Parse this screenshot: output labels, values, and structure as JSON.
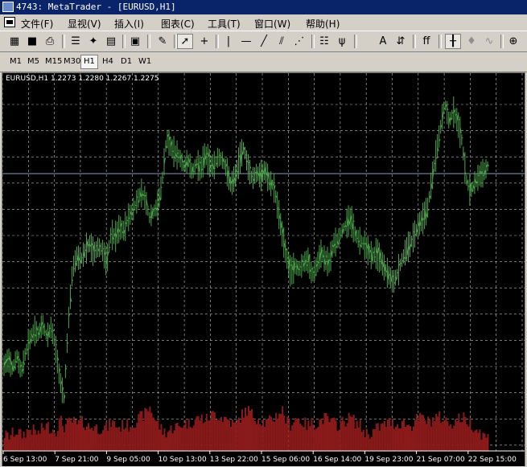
{
  "window": {
    "title": "4743: MetaTrader - [EURUSD,H1]"
  },
  "menu": [
    "文件(F)",
    "显视(V)",
    "插入(I)",
    "图表(C)",
    "工具(T)",
    "窗口(W)",
    "帮助(H)"
  ],
  "toolbar_icons": [
    "new-chart-icon",
    "save-icon",
    "print-icon",
    "market-watch-icon",
    "navigator-icon",
    "terminal-icon",
    "strategy-tester-icon",
    "properties-icon",
    "pencil-icon",
    "cursor-icon",
    "crosshair-icon",
    "vertical-line-icon",
    "horizontal-line-icon",
    "trendline-icon",
    "channel-icon",
    "gann-fan-icon",
    "fibonacci-icon",
    "andrews-pitchfork-icon",
    "text-icon",
    "arrow-label-icon",
    "fibonacci-fan-icon",
    "bar-chart-icon",
    "candlestick-icon",
    "line-chart-icon",
    "zoom-in-icon"
  ],
  "timeframes": [
    "M1",
    "M5",
    "M15",
    "M30",
    "H1",
    "H4",
    "D1",
    "W1"
  ],
  "active_timeframe": "H1",
  "chart": {
    "header": "EURUSD,H1  1.2273 1.2280 1.2267 1.2275",
    "bar_color": "#4ca64c",
    "volume_color": "#8b1a1a",
    "grid_color": "#c0c0c0",
    "price_line_color": "#8a9ab8"
  },
  "chart_data": {
    "type": "bar",
    "symbol": "EURUSD",
    "timeframe": "H1",
    "ohlc": {
      "open": 1.2273,
      "high": 1.228,
      "low": 1.2267,
      "close": 1.2275
    },
    "x_tick_labels": [
      "6 Sep 13:00",
      "7 Sep 21:00",
      "9 Sep 05:00",
      "10 Sep 13:00",
      "13 Sep 22:00",
      "15 Sep 06:00",
      "16 Sep 14:00",
      "19 Sep 23:00",
      "21 Sep 07:00",
      "22 Sep 15:00"
    ],
    "price_path_relative": [
      0.14,
      0.16,
      0.13,
      0.17,
      0.12,
      0.18,
      0.22,
      0.25,
      0.24,
      0.27,
      0.23,
      0.26,
      0.2,
      0.1,
      0.04,
      0.27,
      0.44,
      0.48,
      0.47,
      0.5,
      0.52,
      0.49,
      0.51,
      0.5,
      0.46,
      0.55,
      0.54,
      0.57,
      0.56,
      0.6,
      0.62,
      0.65,
      0.68,
      0.66,
      0.6,
      0.62,
      0.64,
      0.72,
      0.85,
      0.82,
      0.8,
      0.79,
      0.76,
      0.78,
      0.74,
      0.77,
      0.75,
      0.8,
      0.77,
      0.76,
      0.79,
      0.78,
      0.75,
      0.7,
      0.73,
      0.78,
      0.82,
      0.76,
      0.72,
      0.74,
      0.73,
      0.75,
      0.71,
      0.7,
      0.63,
      0.55,
      0.48,
      0.43,
      0.45,
      0.44,
      0.46,
      0.47,
      0.42,
      0.45,
      0.49,
      0.47,
      0.46,
      0.52,
      0.53,
      0.56,
      0.58,
      0.6,
      0.55,
      0.53,
      0.52,
      0.5,
      0.48,
      0.49,
      0.47,
      0.44,
      0.42,
      0.4,
      0.43,
      0.47,
      0.5,
      0.52,
      0.55,
      0.58,
      0.6,
      0.63,
      0.72,
      0.8,
      0.88,
      0.96,
      0.9,
      0.93,
      0.9,
      0.84,
      0.72,
      0.68,
      0.71,
      0.73,
      0.74,
      0.76
    ],
    "volume_relative": [
      0.22,
      0.18,
      0.25,
      0.3,
      0.2,
      0.28,
      0.35,
      0.3,
      0.24,
      0.38,
      0.42,
      0.36,
      0.3,
      0.55,
      0.4,
      0.48,
      0.52,
      0.44,
      0.5,
      0.46,
      0.38,
      0.42,
      0.35,
      0.4,
      0.37,
      0.5,
      0.44,
      0.38,
      0.46,
      0.42,
      0.48,
      0.55,
      0.62,
      0.7,
      0.85,
      0.6,
      0.45,
      0.3,
      0.28,
      0.35,
      0.42,
      0.38,
      0.5,
      0.46,
      0.52,
      0.58,
      0.6,
      0.55,
      0.62,
      0.7,
      0.65,
      0.6,
      0.58,
      0.5,
      0.42,
      0.6,
      0.72,
      0.78,
      0.65,
      0.6,
      0.55,
      0.48,
      0.52,
      0.6,
      0.7,
      0.78,
      0.5,
      0.45,
      0.6,
      0.55,
      0.48,
      0.42,
      0.5,
      0.46,
      0.55,
      0.6,
      0.52,
      0.48,
      0.44,
      0.5,
      0.56,
      0.62,
      0.5,
      0.44,
      0.3,
      0.24,
      0.28,
      0.36,
      0.4,
      0.46,
      0.5,
      0.48,
      0.44,
      0.52,
      0.45,
      0.4,
      0.55,
      0.58,
      0.6,
      0.5,
      0.56,
      0.62,
      0.6,
      0.54,
      0.48,
      0.5,
      0.58,
      0.6,
      0.55,
      0.48,
      0.38,
      0.3,
      0.2,
      0.15
    ]
  }
}
